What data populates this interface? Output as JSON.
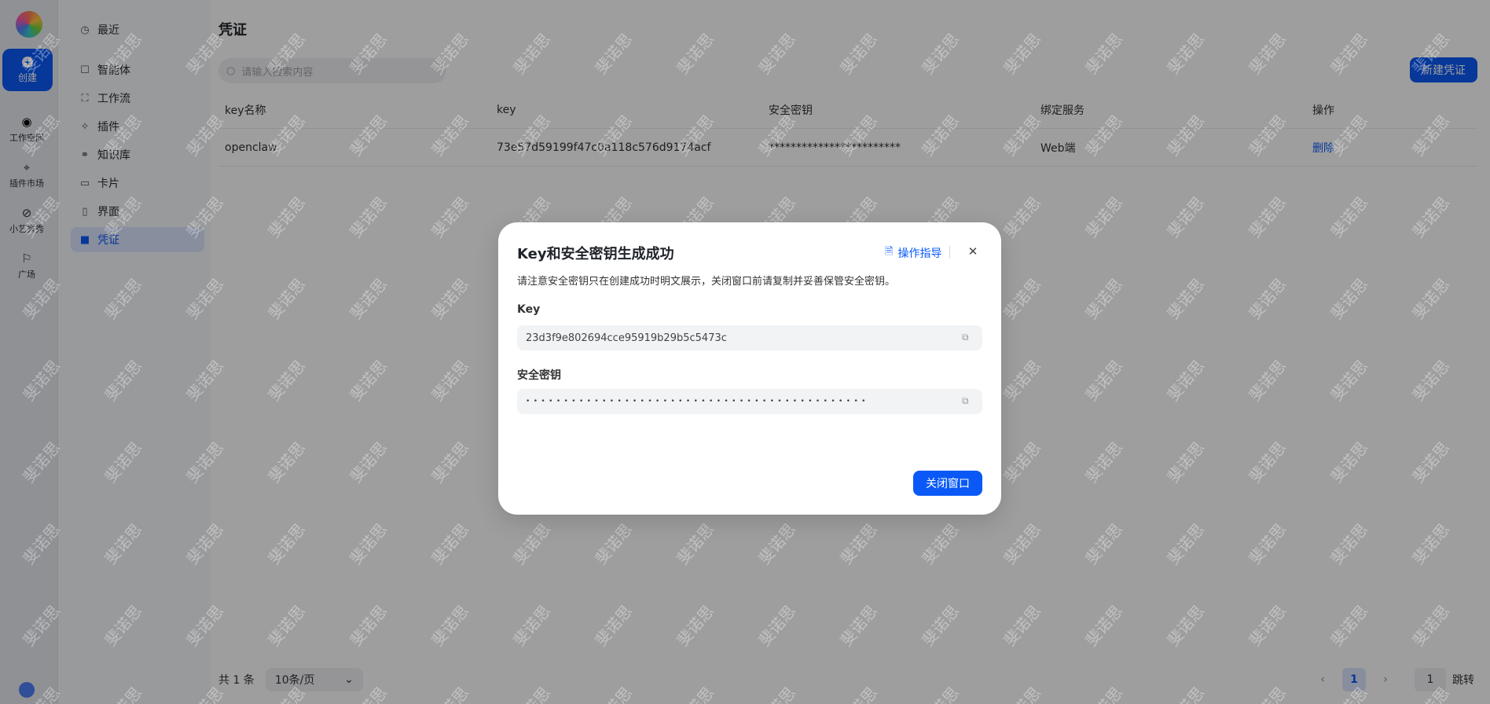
{
  "rail": {
    "create_label": "创建",
    "items": [
      {
        "label": "工作空间",
        "icon": "workspace-icon"
      },
      {
        "label": "插件市场",
        "icon": "plugin-market-icon"
      },
      {
        "label": "小艺秀秀",
        "icon": "compass-icon"
      },
      {
        "label": "广场",
        "icon": "plaza-icon"
      }
    ]
  },
  "sidebar": {
    "items": [
      {
        "label": "最近",
        "icon": "clock-icon"
      },
      {
        "label": "智能体",
        "icon": "robot-icon"
      },
      {
        "label": "工作流",
        "icon": "workflow-icon"
      },
      {
        "label": "插件",
        "icon": "plugin-icon"
      },
      {
        "label": "知识库",
        "icon": "knowledge-icon"
      },
      {
        "label": "卡片",
        "icon": "card-icon"
      },
      {
        "label": "界面",
        "icon": "ui-icon"
      },
      {
        "label": "凭证",
        "icon": "credential-icon",
        "active": true
      }
    ]
  },
  "main": {
    "title": "凭证",
    "search_placeholder": "请输入搜索内容",
    "new_button": "新建凭证",
    "table": {
      "headers": [
        "key名称",
        "key",
        "安全密钥",
        "绑定服务",
        "操作"
      ],
      "rows": [
        {
          "name": "openclaw",
          "key": "73e57d59199f47c0a118c576d9174acf",
          "secret": "************************",
          "service": "Web端",
          "action": "删除"
        }
      ]
    },
    "pagination": {
      "total": "共 1 条",
      "page_size": "10条/页",
      "current_page": "1",
      "jump_value": "1",
      "jump_label": "跳转"
    }
  },
  "watermark": "斐诺思",
  "dialog": {
    "title": "Key和安全密钥生成成功",
    "guide_label": "操作指导",
    "description": "请注意安全密钥只在创建成功时明文展示，关闭窗口前请复制并妥善保管安全密钥。",
    "key_label": "Key",
    "key_value": "23d3f9e802694cce95919b29b5c5473c",
    "secret_label": "安全密钥",
    "secret_value": "•••••••••••••••••••••••••••••••••••••••••••••",
    "close_button": "关闭窗口"
  },
  "colors": {
    "accent": "#0a59f7",
    "active_bg": "#dbe6fd"
  }
}
